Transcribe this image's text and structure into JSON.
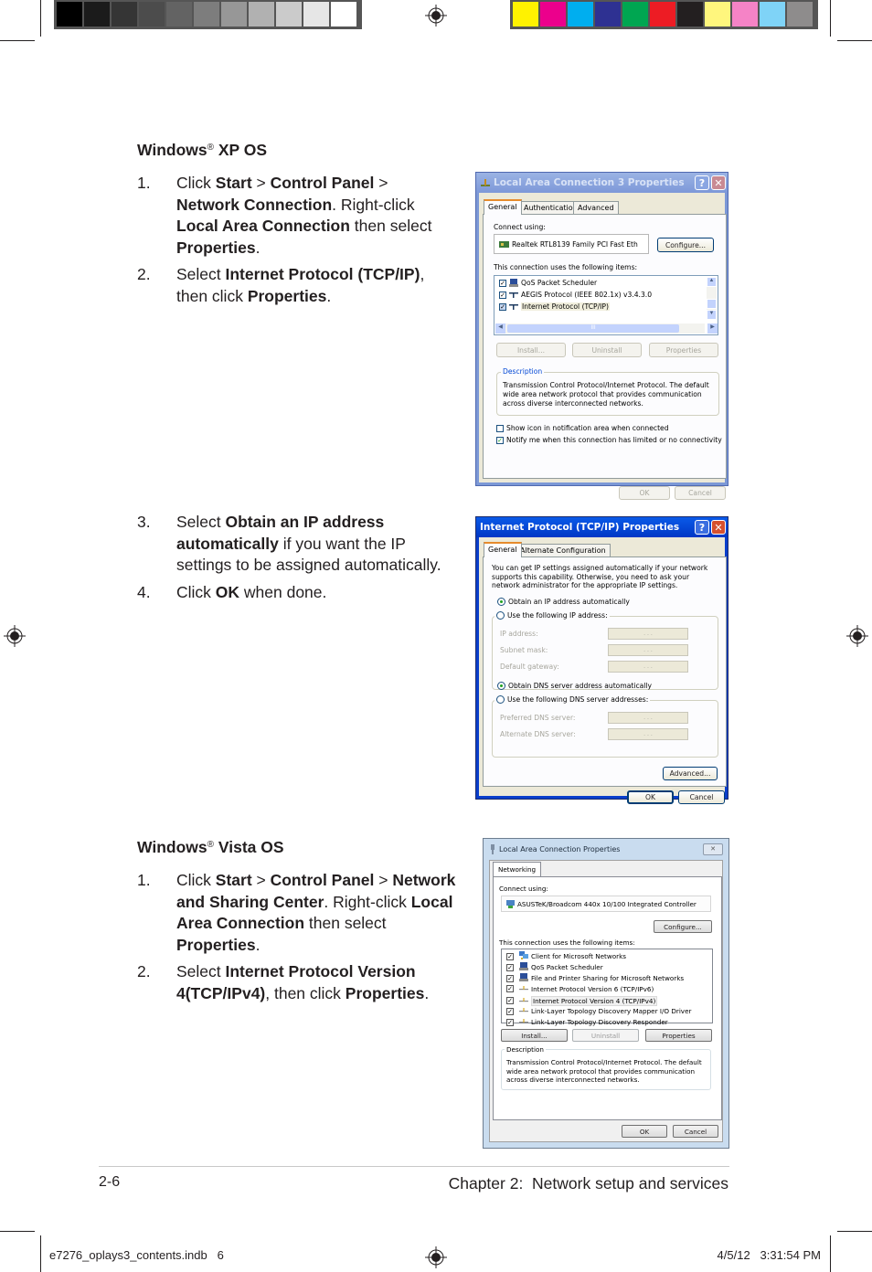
{
  "printer_marks": {
    "grey_swatches": [
      "#000000",
      "#1b1b1b",
      "#353535",
      "#4c4c4c",
      "#636363",
      "#7d7d7d",
      "#979797",
      "#b1b1b1",
      "#cbcbcb",
      "#e6e6e6",
      "#ffffff"
    ],
    "color_swatches": [
      "#fff200",
      "#ec008c",
      "#00aeef",
      "#2e3192",
      "#00a651",
      "#ed1c24",
      "#231f20",
      "#fff67d",
      "#f583c6",
      "#7fd3f7",
      "#8e8c8c"
    ]
  },
  "xp_section": {
    "heading_pre": "Windows",
    "heading_reg": "®",
    "heading_post": " XP OS",
    "steps": [
      {
        "num": "1.",
        "parts": [
          [
            "Click ",
            false
          ],
          [
            "Start",
            true
          ],
          [
            " > ",
            false
          ],
          [
            "Control Panel",
            true
          ],
          [
            " > ",
            false
          ],
          [
            "Network Connection",
            true
          ],
          [
            ". Right-click ",
            false
          ],
          [
            "Local Area Connection",
            true
          ],
          [
            " then select ",
            false
          ],
          [
            "Properties",
            true
          ],
          [
            ".",
            false
          ]
        ]
      },
      {
        "num": "2.",
        "parts": [
          [
            "Select ",
            false
          ],
          [
            "Internet Protocol (TCP/IP)",
            true
          ],
          [
            ", then click ",
            false
          ],
          [
            "Properties",
            true
          ],
          [
            ".",
            false
          ]
        ]
      },
      {
        "num": "3.",
        "parts": [
          [
            "Select ",
            false
          ],
          [
            "Obtain an IP address automatically",
            true
          ],
          [
            " if you want the IP settings to be assigned automatically.",
            false
          ]
        ]
      },
      {
        "num": "4.",
        "parts": [
          [
            "Click ",
            false
          ],
          [
            "OK",
            true
          ],
          [
            " when done.",
            false
          ]
        ]
      }
    ]
  },
  "vista_section": {
    "heading_pre": "Windows",
    "heading_reg": "®",
    "heading_post": " Vista OS",
    "steps": [
      {
        "num": "1.",
        "parts": [
          [
            "Click ",
            false
          ],
          [
            "Start",
            true
          ],
          [
            " > ",
            false
          ],
          [
            "Control Panel",
            true
          ],
          [
            " > ",
            false
          ],
          [
            "Network and Sharing Center",
            true
          ],
          [
            ". Right-click ",
            false
          ],
          [
            "Local Area Connection",
            true
          ],
          [
            " then select ",
            false
          ],
          [
            "Properties",
            true
          ],
          [
            ".",
            false
          ]
        ]
      },
      {
        "num": "2.",
        "parts": [
          [
            "Select ",
            false
          ],
          [
            "Internet Protocol Version 4(TCP/IPv4)",
            true
          ],
          [
            ", then click ",
            false
          ],
          [
            "Properties",
            true
          ],
          [
            ".",
            false
          ]
        ]
      }
    ]
  },
  "dialog_xp_lan": {
    "title": "Local Area Connection 3 Properties",
    "help": "?",
    "close": "✕",
    "tabs": [
      "General",
      "Authentication",
      "Advanced"
    ],
    "connect_using_label": "Connect using:",
    "adapter": "Realtek RTL8139 Family PCI Fast Eth",
    "configure": "Configure...",
    "items_label": "This connection uses the following items:",
    "items": [
      {
        "label": "QoS Packet Scheduler",
        "checked": true,
        "selected": false
      },
      {
        "label": "AEGIS Protocol (IEEE 802.1x) v3.4.3.0",
        "checked": true,
        "selected": false
      },
      {
        "label": "Internet Protocol (TCP/IP)",
        "checked": true,
        "selected": true
      }
    ],
    "scroll_mid": "III",
    "install": "Install...",
    "uninstall": "Uninstall",
    "properties": "Properties",
    "description_label": "Description",
    "description": "Transmission Control Protocol/Internet Protocol. The default wide area network protocol that provides communication across diverse interconnected networks.",
    "show_icon": {
      "label": "Show icon in notification area when connected",
      "checked": false
    },
    "notify": {
      "label": "Notify me when this connection has limited or no connectivity",
      "checked": true
    },
    "ok": "OK",
    "cancel": "Cancel"
  },
  "dialog_xp_tcpip": {
    "title": "Internet Protocol (TCP/IP) Properties",
    "help": "?",
    "close": "✕",
    "tabs": [
      "General",
      "Alternate Configuration"
    ],
    "intro": "You can get IP settings assigned automatically if your network supports this capability. Otherwise, you need to ask your network administrator for the appropriate IP settings.",
    "obtain_ip": {
      "label": "Obtain an IP address automatically",
      "selected": true
    },
    "use_ip": {
      "label": "Use the following IP address:",
      "selected": false
    },
    "ip_fields": [
      {
        "label": "IP address:",
        "value": ". . ."
      },
      {
        "label": "Subnet mask:",
        "value": ". . ."
      },
      {
        "label": "Default gateway:",
        "value": ". . ."
      }
    ],
    "obtain_dns": {
      "label": "Obtain DNS server address automatically",
      "selected": true
    },
    "use_dns": {
      "label": "Use the following DNS server addresses:",
      "selected": false
    },
    "dns_fields": [
      {
        "label": "Preferred DNS server:",
        "value": ". . ."
      },
      {
        "label": "Alternate DNS server:",
        "value": ". . ."
      }
    ],
    "advanced": "Advanced...",
    "ok": "OK",
    "cancel": "Cancel"
  },
  "dialog_vista_lan": {
    "title": "Local Area Connection Properties",
    "close": "✕",
    "tabs": [
      "Networking"
    ],
    "connect_using_label": "Connect using:",
    "adapter": "ASUSTeK/Broadcom 440x 10/100 Integrated Controller",
    "configure": "Configure...",
    "items_label": "This connection uses the following items:",
    "items": [
      {
        "label": "Client for Microsoft Networks",
        "checked": true,
        "selected": false,
        "icon": "network-client"
      },
      {
        "label": "QoS Packet Scheduler",
        "checked": true,
        "selected": false,
        "icon": "computer"
      },
      {
        "label": "File and Printer Sharing for Microsoft Networks",
        "checked": true,
        "selected": false,
        "icon": "computer"
      },
      {
        "label": "Internet Protocol Version 6 (TCP/IPv6)",
        "checked": true,
        "selected": false,
        "icon": "protocol"
      },
      {
        "label": "Internet Protocol Version 4 (TCP/IPv4)",
        "checked": true,
        "selected": true,
        "icon": "protocol"
      },
      {
        "label": "Link-Layer Topology Discovery Mapper I/O Driver",
        "checked": true,
        "selected": false,
        "icon": "protocol"
      },
      {
        "label": "Link-Layer Topology Discovery Responder",
        "checked": true,
        "selected": false,
        "icon": "protocol"
      }
    ],
    "install": "Install...",
    "uninstall": "Uninstall",
    "properties": "Properties",
    "description_label": "Description",
    "description": "Transmission Control Protocol/Internet Protocol. The default wide area network protocol that provides communication across diverse interconnected networks.",
    "ok": "OK",
    "cancel": "Cancel"
  },
  "footer": {
    "page_number": "2-6",
    "chapter": "Chapter 2:  Network setup and services",
    "slug_file": "e7276_oplays3_contents.indb   6",
    "slug_date": "4/5/12   3:31:54 PM"
  }
}
